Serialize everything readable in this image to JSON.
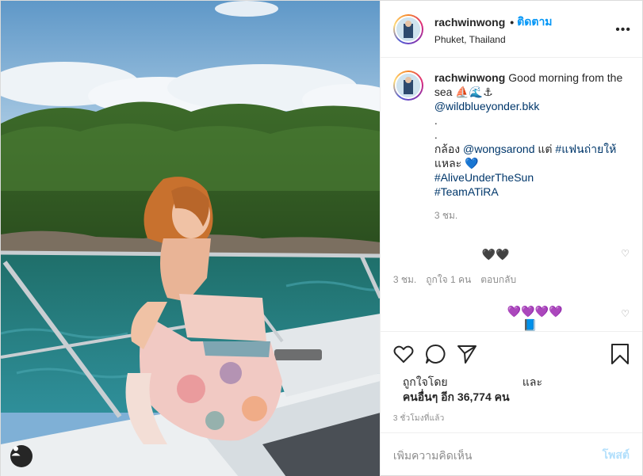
{
  "post": {
    "username": "rachwinwong",
    "separator": "•",
    "follow_label": "ติดตาม",
    "location": "Phuket, Thailand",
    "more_icon": "more-horizontal-icon"
  },
  "caption": {
    "username": "rachwinwong",
    "line1": "Good morning from the sea",
    "emojis": "⛵🌊⚓",
    "mention1": "@wildblueyonder.bkk",
    "dot1": ".",
    "dot2": ".",
    "camera_prefix": "กล้อง",
    "mention2": "@wongsarond",
    "but": "แต่",
    "hashtag1": "#แฟนถ่ายให้",
    "line_end": "แหละ",
    "blue_heart": "💙",
    "hashtag2": "#AliveUnderTheSun",
    "hashtag3": "#TeamATiRA",
    "time": "3 ชม."
  },
  "replies": [
    {
      "text": "🖤🖤",
      "time": "3 ชม.",
      "likes": "ถูกใจ 1 คน",
      "reply_label": "ตอบกลับ"
    },
    {
      "text": "💜💜💜💜",
      "text2": "📘"
    }
  ],
  "actions": {
    "like_icon": "heart-icon",
    "comment_icon": "comment-icon",
    "share_icon": "send-icon",
    "save_icon": "bookmark-icon"
  },
  "likes": {
    "liked_by": "ถูกใจโดย",
    "and": "และ",
    "others": "คนอื่นๆ อีก 36,774 คน"
  },
  "timestamp": "3 ชั่วโมงที่แล้ว",
  "comment_box": {
    "placeholder": "เพิ่มความคิดเห็น",
    "post_label": "โพสต์"
  },
  "colors": {
    "link": "#00376b",
    "follow": "#0095f6",
    "post_disabled": "#b2dffc"
  }
}
